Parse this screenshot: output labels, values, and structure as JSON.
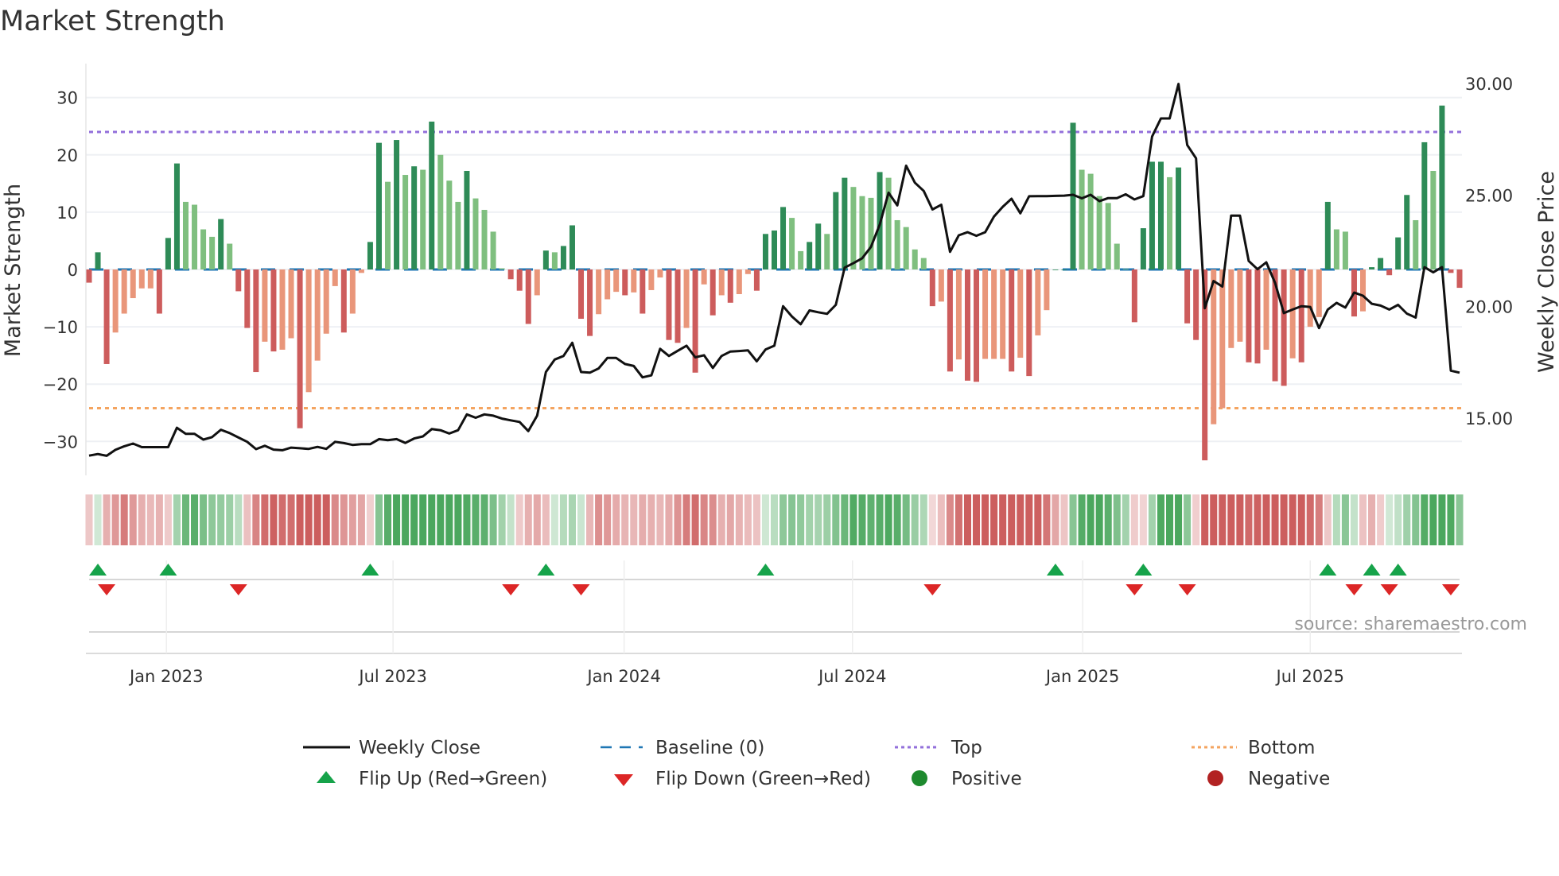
{
  "chart_data": {
    "type": "bar",
    "title": "Market Strength",
    "ylabel": "Market Strength",
    "y2label": "Weekly Close Price",
    "ylim": [
      -35,
      35
    ],
    "y2lim": [
      12.5,
      30.5
    ],
    "yticks": [
      -30,
      -20,
      -10,
      0,
      10,
      20,
      30
    ],
    "y2ticks": [
      {
        "value": 15,
        "label": "15.00"
      },
      {
        "value": 20,
        "label": "20.00"
      },
      {
        "value": 25,
        "label": "25.00"
      },
      {
        "value": 30,
        "label": "30.00"
      }
    ],
    "xticks": [
      {
        "week": 8.8,
        "label": "Jan 2023"
      },
      {
        "week": 34.6,
        "label": "Jul 2023"
      },
      {
        "week": 60.9,
        "label": "Jan 2024"
      },
      {
        "week": 86.9,
        "label": "Jul 2024"
      },
      {
        "week": 113.1,
        "label": "Jan 2025"
      },
      {
        "week": 139.0,
        "label": "Jul 2025"
      }
    ],
    "top_level": 24,
    "bottom_level": -24.2,
    "baseline": 0,
    "strength": [
      -2.3,
      3,
      -16.5,
      -11,
      -7.7,
      -5,
      -3.3,
      -3.3,
      -7.7,
      5.5,
      18.5,
      11.8,
      11.3,
      7,
      5.7,
      8.8,
      4.5,
      -3.8,
      -10.2,
      -17.9,
      -12.6,
      -14.3,
      -14,
      -12,
      -27.7,
      -21.4,
      -15.9,
      -11.2,
      -2.9,
      -11,
      -7.7,
      -0.6,
      4.8,
      22.1,
      15.3,
      22.6,
      16.5,
      18,
      17.4,
      25.8,
      20,
      15.5,
      11.8,
      17.2,
      12.4,
      10.4,
      6.6,
      0.2,
      -1.7,
      -3.7,
      -9.5,
      -4.5,
      3.3,
      3,
      4.1,
      7.7,
      -8.6,
      -11.6,
      -7.8,
      -5.2,
      -3.9,
      -4.5,
      -4,
      -7.7,
      -3.6,
      -1.4,
      -12.3,
      -12.8,
      -10.2,
      -18,
      -2.6,
      -8,
      -4.5,
      -5.8,
      -4.3,
      -0.8,
      -3.7,
      6.2,
      6.8,
      10.9,
      9,
      3.2,
      4.8,
      8,
      6.2,
      13.5,
      16,
      14.4,
      12.8,
      12.5,
      17,
      16,
      8.6,
      7.4,
      3.5,
      2,
      -6.4,
      -5.6,
      -17.8,
      -15.7,
      -19.4,
      -19.6,
      -15.6,
      -15.6,
      -15.6,
      -17.8,
      -15.4,
      -18.6,
      -11.5,
      -7.1,
      0,
      0,
      25.6,
      17.4,
      16.7,
      12.8,
      11.6,
      4.5,
      0.1,
      -9.2,
      7.2,
      18.8,
      18.8,
      16.1,
      17.8,
      -9.4,
      -12.3,
      -33.3,
      -27,
      -24.2,
      -13.7,
      -12.6,
      -16.2,
      -16.4,
      -14,
      -19.5,
      -20.3,
      -15.5,
      -16.2,
      -10,
      -8.3,
      11.8,
      7,
      6.6,
      -8.2,
      -7.3,
      0.4,
      2,
      -1,
      5.6,
      13,
      8.6,
      22.2,
      17.2,
      28.6,
      -0.6,
      -3.2
    ],
    "weekly_close": [
      13.31,
      13.38,
      13.3,
      13.57,
      13.73,
      13.85,
      13.69,
      13.69,
      13.69,
      13.69,
      14.56,
      14.29,
      14.29,
      14.03,
      14.14,
      14.47,
      14.32,
      14.12,
      13.93,
      13.6,
      13.75,
      13.58,
      13.55,
      13.67,
      13.64,
      13.61,
      13.7,
      13.61,
      13.93,
      13.87,
      13.79,
      13.82,
      13.82,
      14.05,
      14.0,
      14.05,
      13.88,
      14.08,
      14.17,
      14.5,
      14.45,
      14.3,
      14.45,
      15.16,
      15.01,
      15.16,
      15.1,
      14.97,
      14.89,
      14.82,
      14.41,
      15.1,
      17.06,
      17.62,
      17.78,
      18.37,
      17.06,
      17.03,
      17.22,
      17.69,
      17.69,
      17.42,
      17.33,
      16.82,
      16.91,
      18.1,
      17.78,
      18.01,
      18.24,
      17.72,
      17.81,
      17.24,
      17.78,
      17.98,
      18.0,
      18.03,
      17.54,
      18.07,
      18.24,
      20.01,
      19.55,
      19.2,
      19.82,
      19.74,
      19.67,
      20.07,
      21.74,
      21.94,
      22.16,
      22.67,
      23.67,
      25.1,
      24.53,
      26.31,
      25.55,
      25.18,
      24.35,
      24.56,
      22.45,
      23.19,
      23.33,
      23.17,
      23.33,
      24.03,
      24.47,
      24.83,
      24.18,
      24.94,
      24.95,
      24.95,
      24.96,
      24.97,
      25.01,
      24.85,
      25.01,
      24.72,
      24.86,
      24.86,
      25.03,
      24.8,
      24.95,
      27.62,
      28.43,
      28.43,
      29.98,
      27.24,
      26.64,
      19.92,
      21.14,
      20.89,
      24.07,
      24.07,
      22.04,
      21.67,
      21.98,
      21.05,
      19.7,
      19.86,
      20.01,
      19.98,
      19.03,
      19.86,
      20.16,
      19.95,
      20.62,
      20.48,
      20.12,
      20.04,
      19.86,
      20.07,
      19.68,
      19.5,
      21.76,
      21.53,
      21.76,
      17.12,
      17.03
    ],
    "flip_up_weeks": [
      1,
      9,
      32,
      52,
      77,
      110,
      120,
      141,
      146,
      149
    ],
    "flip_down_weeks": [
      2,
      17,
      48,
      56,
      96,
      119,
      125,
      144,
      148,
      155
    ],
    "legend": {
      "weekly_close": "Weekly Close",
      "baseline": "Baseline (0)",
      "top": "Top",
      "bottom": "Bottom",
      "flip_up": "Flip Up (Red→Green)",
      "flip_down": "Flip Down (Green→Red)",
      "positive": "Positive",
      "negative": "Negative"
    },
    "legend_placement": "bottom",
    "source": "source: sharemaestro.com"
  },
  "colors": {
    "pos_strong": "#2e8b57",
    "pos_weak": "#7fbf7f",
    "neg_strong": "#cd5c5c",
    "neg_weak": "#e9967a",
    "baseline": "#1f77b4",
    "top": "#9370db",
    "bottom": "#f4a460",
    "price": "#111111",
    "flip_up": "#16a34a",
    "flip_down": "#dc2626",
    "positive": "#1e8a2e",
    "negative": "#b22222"
  }
}
